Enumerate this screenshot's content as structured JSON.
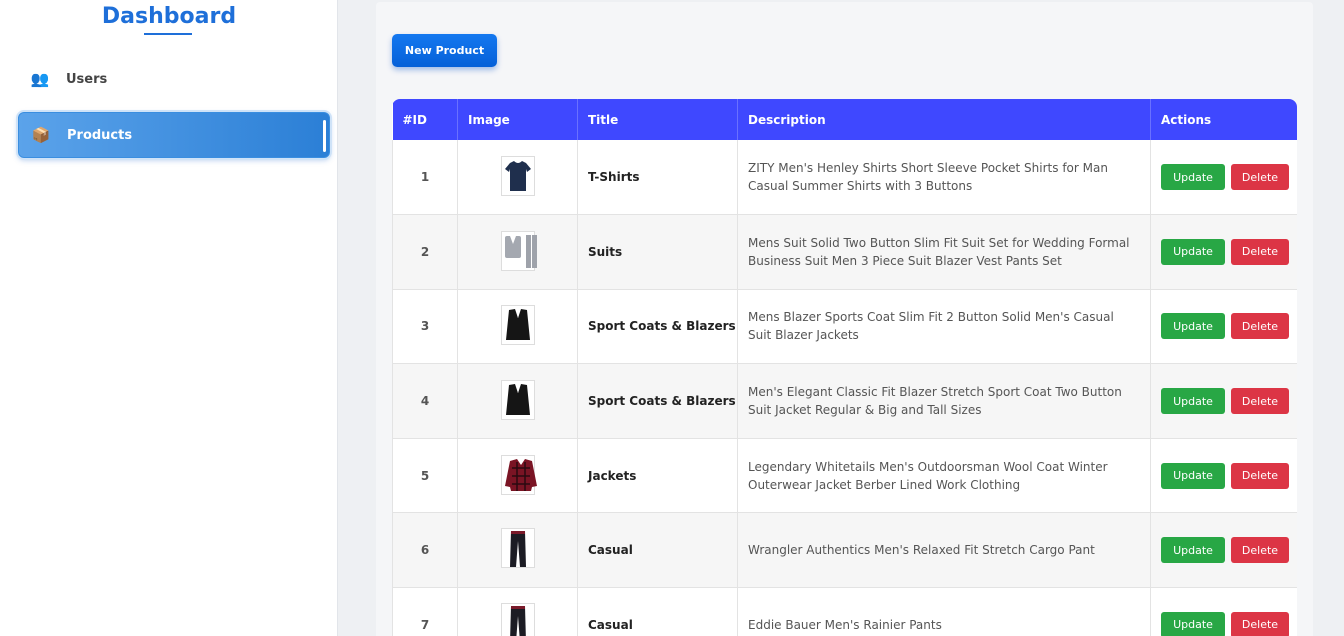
{
  "sidebar": {
    "brand": "Dashboard",
    "items": [
      {
        "label": "Users",
        "icon": "users-icon"
      },
      {
        "label": "Products",
        "icon": "package-icon"
      }
    ]
  },
  "toolbar": {
    "new_product_label": "New Product"
  },
  "table": {
    "headers": [
      "#ID",
      "Image",
      "Title",
      "Description",
      "Actions"
    ],
    "update_label": "Update",
    "delete_label": "Delete",
    "rows": [
      {
        "id": "1",
        "title": "T-Shirts",
        "description": "ZITY Men's Henley Shirts Short Sleeve Pocket Shirts for Man Casual Summer Shirts with 3 Buttons",
        "image": "tshirt-image"
      },
      {
        "id": "2",
        "title": "Suits",
        "description": "Mens Suit Solid Two Button Slim Fit Suit Set for Wedding Formal Business Suit Men 3 Piece Suit Blazer Vest Pants Set",
        "image": "suit-image"
      },
      {
        "id": "3",
        "title": "Sport Coats & Blazers",
        "description": "Mens Blazer Sports Coat Slim Fit 2 Button Solid Men's Casual Suit Blazer Jackets",
        "image": "blazer-image"
      },
      {
        "id": "4",
        "title": "Sport Coats & Blazers",
        "description": "Men's Elegant Classic Fit Blazer Stretch Sport Coat Two Button Suit Jacket Regular & Big and Tall Sizes",
        "image": "blazer-image"
      },
      {
        "id": "5",
        "title": "Jackets",
        "description": "Legendary Whitetails Men's Outdoorsman Wool Coat Winter Outerwear Jacket Berber Lined Work Clothing",
        "image": "jacket-image"
      },
      {
        "id": "6",
        "title": "Casual",
        "description": "Wrangler Authentics Men's Relaxed Fit Stretch Cargo Pant",
        "image": "pants-image"
      },
      {
        "id": "7",
        "title": "Casual",
        "description": "Eddie Bauer Men's Rainier Pants",
        "image": "pants-image"
      }
    ]
  },
  "colors": {
    "brand": "#1e6fd9",
    "table_header": "#3f48ff",
    "update": "#28a745",
    "delete": "#dc3545",
    "active_nav": "#2b7fd6"
  }
}
